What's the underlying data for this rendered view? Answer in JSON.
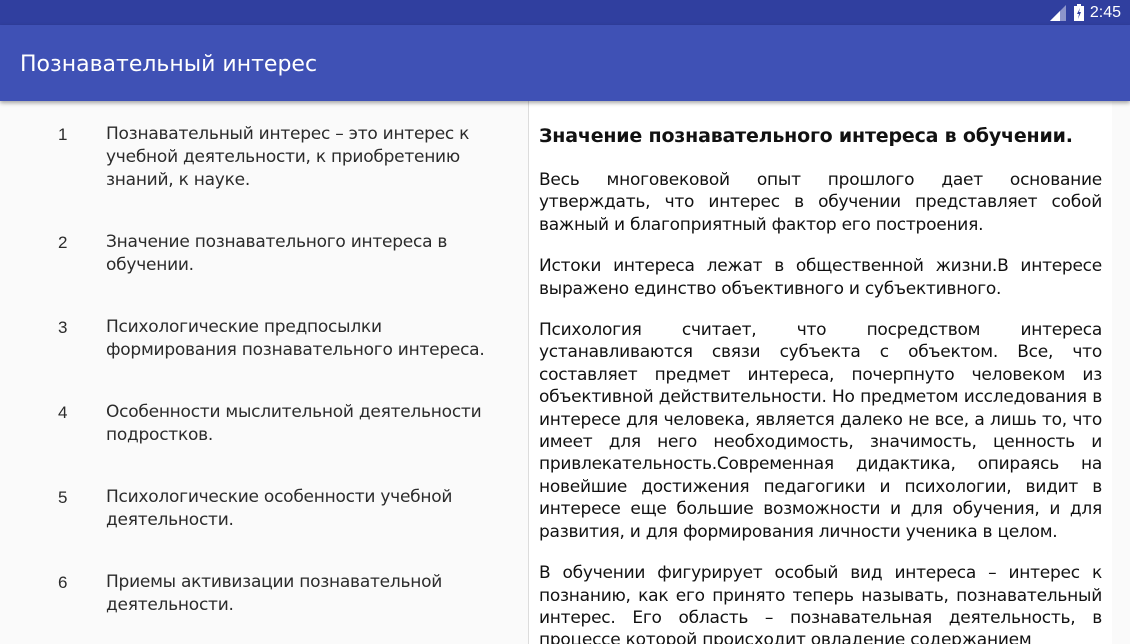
{
  "status_bar": {
    "time": "2:45",
    "icons": [
      "signal-icon",
      "battery-icon"
    ]
  },
  "app_bar": {
    "title": "Познавательный интерес"
  },
  "toc": {
    "items": [
      {
        "number": "1",
        "text": "Познавательный интерес – это интерес к учебной деятельности, к приобретению знаний, к науке."
      },
      {
        "number": "2",
        "text": "Значение познавательного интереса в обучении."
      },
      {
        "number": "3",
        "text": "Психологические предпосылки формирования познавательного интереса."
      },
      {
        "number": "4",
        "text": "Особенности мыслительной деятельности подростков."
      },
      {
        "number": "5",
        "text": "Психологические особенности учебной деятельности."
      },
      {
        "number": "6",
        "text": "Приемы активизации познавательной деятельности."
      }
    ]
  },
  "article": {
    "heading": "Значение познавательного интереса в обучении.",
    "paragraphs": [
      "Весь многовековой опыт прошлого дает основание утверждать, что интерес в обучении представляет собой важный и благоприятный фактор его построения.",
      "Истоки интереса лежат в общественной жизни.В интересе выражено единство объективного и субъективного.",
      "Психология считает, что посредством интереса устанавливаются связи субъекта с объектом. Все, что составляет предмет интереса, почерпнуто человеком из объективной действительности. Но предметом исследования в интересе для человека, является далеко не все, а лишь то, что имеет для него необходимость, значимость, ценность и привлекательность.Современная дидактика, опираясь на новейшие достижения педагогики и психологии, видит в интересе еще большие возможности и для обучения, и для развития, и для формирования личности ученика в целом.",
      "В обучении фигурирует особый вид интереса – интерес к познанию, как его принято теперь называть, познавательный интерес. Его область – познавательная деятельность, в процессе которой происходит овладение содержанием"
    ]
  },
  "colors": {
    "status_bar": "#303f9f",
    "app_bar": "#3f51b5",
    "left_background": "#fafafa",
    "content_background": "#ffffff"
  }
}
